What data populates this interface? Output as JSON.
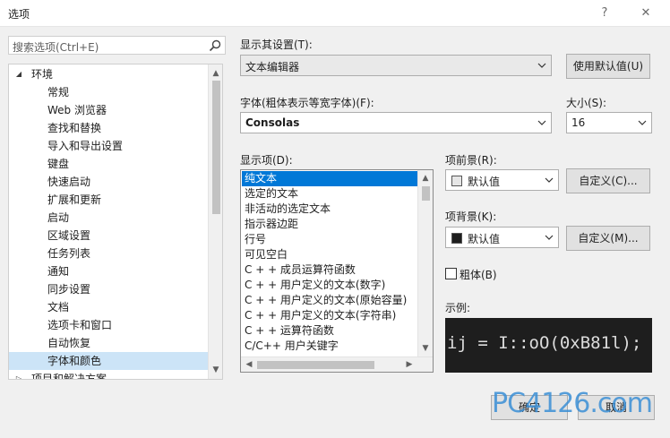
{
  "window": {
    "title": "选项",
    "help": "?",
    "close": "✕"
  },
  "search": {
    "placeholder": "搜索选项(Ctrl+E)"
  },
  "tree": {
    "root_label": "环境",
    "items": [
      {
        "label": "常规"
      },
      {
        "label": "Web 浏览器"
      },
      {
        "label": "查找和替换"
      },
      {
        "label": "导入和导出设置"
      },
      {
        "label": "键盘"
      },
      {
        "label": "快速启动"
      },
      {
        "label": "扩展和更新"
      },
      {
        "label": "启动"
      },
      {
        "label": "区域设置"
      },
      {
        "label": "任务列表"
      },
      {
        "label": "通知"
      },
      {
        "label": "同步设置"
      },
      {
        "label": "文档"
      },
      {
        "label": "选项卡和窗口"
      },
      {
        "label": "自动恢复"
      },
      {
        "label": "字体和颜色",
        "selected": true
      }
    ],
    "next_root_label": "项目和解决方案"
  },
  "display_settings": {
    "label": "显示其设置(T):",
    "value": "文本编辑器",
    "defaults_button": "使用默认值(U)"
  },
  "font": {
    "label": "字体(粗体表示等宽字体)(F):",
    "value": "Consolas"
  },
  "size": {
    "label": "大小(S):",
    "value": "16"
  },
  "display_items": {
    "label": "显示项(D):",
    "items": [
      {
        "label": "纯文本",
        "selected": true
      },
      {
        "label": "选定的文本"
      },
      {
        "label": "非活动的选定文本"
      },
      {
        "label": "指示器边距"
      },
      {
        "label": "行号"
      },
      {
        "label": "可见空白"
      },
      {
        "label": "C + + 成员运算符函数"
      },
      {
        "label": "C + + 用户定义的文本(数字)"
      },
      {
        "label": "C + + 用户定义的文本(原始容量)"
      },
      {
        "label": "C + + 用户定义的文本(字符串)"
      },
      {
        "label": "C + + 运算符函数"
      },
      {
        "label": "C/C++ 用户关键字"
      }
    ]
  },
  "foreground": {
    "label": "项前景(R):",
    "value": "默认值",
    "swatch_color": "#e6e6e6",
    "custom_button": "自定义(C)..."
  },
  "background": {
    "label": "项背景(K):",
    "value": "默认值",
    "swatch_color": "#1e1e1e",
    "custom_button": "自定义(M)..."
  },
  "bold": {
    "label": "粗体(B)",
    "checked": false
  },
  "sample": {
    "label": "示例:",
    "text": "ij = I::oO(0xB81l);"
  },
  "footer": {
    "ok_button": "确定",
    "cancel_button": "取消"
  },
  "watermark": {
    "text": "PC4126.com"
  },
  "colors": {
    "accent": "#0078d7",
    "tree_selection": "#cce4f7",
    "watermark": "#3b8fd6"
  }
}
